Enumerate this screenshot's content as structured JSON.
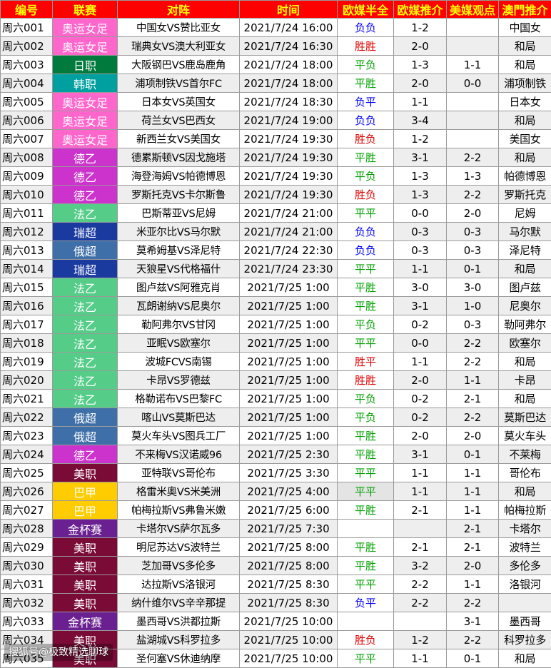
{
  "header": {
    "id": "编号",
    "league": "联赛",
    "match": "对阵",
    "time": "时间",
    "eu_halffull": "欧媒半全",
    "eu_recommend": "欧媒推介",
    "us_view": "美媒观点",
    "macau_recommend": "澳門推介"
  },
  "league_colors": {
    "奥运女足": "#ff66cc",
    "日职": "#007a3d",
    "韩职": "#00a0a0",
    "德乙": "#cc33cc",
    "法乙": "#55cc88",
    "瑞超": "#1a3aa0",
    "俄超": "#3f6fa8",
    "美职": "#7a0a36",
    "巴甲": "#ffcc00",
    "金杯赛": "#6a2090"
  },
  "rows": [
    {
      "id": "周六001",
      "league": "奥运女足",
      "match": "中国女VS赞比亚女",
      "time": "2021/7/24 16:00",
      "odds": "负负",
      "odds_color": "blue",
      "recommend": "1-2",
      "us": "",
      "macau": "中国女"
    },
    {
      "id": "周六002",
      "league": "奥运女足",
      "match": "瑞典女VS澳大利亚女",
      "time": "2021/7/24 16:30",
      "odds": "胜胜",
      "odds_color": "red",
      "recommend": "2-0",
      "us": "",
      "macau": "和局"
    },
    {
      "id": "周六003",
      "league": "日职",
      "match": "大阪钢巴VS鹿岛鹿角",
      "time": "2021/7/24 18:00",
      "odds": "平负",
      "odds_color": "green",
      "recommend": "1-3",
      "us": "1-1",
      "macau": "和局"
    },
    {
      "id": "周六004",
      "league": "韩职",
      "match": "浦项制铁VS首尔FC",
      "time": "2021/7/24 18:00",
      "odds": "平胜",
      "odds_color": "green",
      "recommend": "2-0",
      "us": "0-0",
      "macau": "浦项制铁"
    },
    {
      "id": "周六005",
      "league": "奥运女足",
      "match": "日本女VS英国女",
      "time": "2021/7/24 18:30",
      "odds": "负平",
      "odds_color": "blue",
      "recommend": "1-1",
      "us": "",
      "macau": "日本女"
    },
    {
      "id": "周六006",
      "league": "奥运女足",
      "match": "荷兰女VS巴西女",
      "time": "2021/7/24 19:00",
      "odds": "负负",
      "odds_color": "blue",
      "recommend": "3-4",
      "us": "",
      "macau": "和局"
    },
    {
      "id": "周六007",
      "league": "奥运女足",
      "match": "新西兰女VS美国女",
      "time": "2021/7/24 19:30",
      "odds": "胜负",
      "odds_color": "red",
      "recommend": "1-2",
      "us": "",
      "macau": "美国女"
    },
    {
      "id": "周六008",
      "league": "德乙",
      "match": "德累斯顿VS因戈施塔",
      "time": "2021/7/24 19:30",
      "odds": "平胜",
      "odds_color": "green",
      "recommend": "3-1",
      "us": "2-2",
      "macau": "和局"
    },
    {
      "id": "周六009",
      "league": "德乙",
      "match": "海登海姆VS帕德博恩",
      "time": "2021/7/24 19:30",
      "odds": "平负",
      "odds_color": "green",
      "recommend": "1-3",
      "us": "1-3",
      "macau": "帕德博恩"
    },
    {
      "id": "周六010",
      "league": "德乙",
      "match": "罗斯托克VS卡尔斯鲁",
      "time": "2021/7/24 19:30",
      "odds": "胜负",
      "odds_color": "red",
      "recommend": "1-3",
      "us": "2-2",
      "macau": "罗斯托克"
    },
    {
      "id": "周六011",
      "league": "法乙",
      "match": "巴斯蒂亚VS尼姆",
      "time": "2021/7/24 21:00",
      "odds": "平平",
      "odds_color": "green",
      "recommend": "0-0",
      "us": "2-0",
      "macau": "尼姆"
    },
    {
      "id": "周六012",
      "league": "瑞超",
      "match": "米亚尔比VS马尔默",
      "time": "2021/7/24 21:00",
      "odds": "负负",
      "odds_color": "blue",
      "recommend": "0-3",
      "us": "0-3",
      "macau": "马尔默"
    },
    {
      "id": "周六013",
      "league": "俄超",
      "match": "莫希姆基VS泽尼特",
      "time": "2021/7/24 22:30",
      "odds": "负负",
      "odds_color": "blue",
      "recommend": "0-3",
      "us": "0-3",
      "macau": "泽尼特"
    },
    {
      "id": "周六014",
      "league": "瑞超",
      "match": "天狼星VS代格福什",
      "time": "2021/7/24 23:30",
      "odds": "平平",
      "odds_color": "green",
      "recommend": "1-1",
      "us": "0-1",
      "macau": "和局"
    },
    {
      "id": "周六015",
      "league": "法乙",
      "match": "图卢兹VS阿雅克肖",
      "time": "2021/7/25 1:00",
      "odds": "平胜",
      "odds_color": "green",
      "recommend": "3-0",
      "us": "3-0",
      "macau": "图卢兹"
    },
    {
      "id": "周六016",
      "league": "法乙",
      "match": "瓦朗谢纳VS尼奥尔",
      "time": "2021/7/25 1:00",
      "odds": "平胜",
      "odds_color": "green",
      "recommend": "3-1",
      "us": "1-0",
      "macau": "尼奥尔"
    },
    {
      "id": "周六017",
      "league": "法乙",
      "match": "勒阿弗尔VS甘冈",
      "time": "2021/7/25 1:00",
      "odds": "平负",
      "odds_color": "green",
      "recommend": "0-2",
      "us": "0-3",
      "macau": "勒阿弗尔"
    },
    {
      "id": "周六018",
      "league": "法乙",
      "match": "亚眠VS欧塞尔",
      "time": "2021/7/25 1:00",
      "odds": "平平",
      "odds_color": "green",
      "recommend": "0-0",
      "us": "2-2",
      "macau": "欧塞尔"
    },
    {
      "id": "周六019",
      "league": "法乙",
      "match": "波城FCVS南锡",
      "time": "2021/7/25 1:00",
      "odds": "胜平",
      "odds_color": "red",
      "recommend": "1-1",
      "us": "2-2",
      "macau": "和局"
    },
    {
      "id": "周六020",
      "league": "法乙",
      "match": "卡昂VS罗德兹",
      "time": "2021/7/25 1:00",
      "odds": "胜胜",
      "odds_color": "red",
      "recommend": "2-0",
      "us": "1-1",
      "macau": "卡昂"
    },
    {
      "id": "周六021",
      "league": "法乙",
      "match": "格勒诺布VS巴黎FC",
      "time": "2021/7/25 1:00",
      "odds": "平负",
      "odds_color": "green",
      "recommend": "0-2",
      "us": "2-1",
      "macau": "和局"
    },
    {
      "id": "周六022",
      "league": "俄超",
      "match": "喀山VS莫斯巴达",
      "time": "2021/7/25 1:00",
      "odds": "平负",
      "odds_color": "green",
      "recommend": "0-2",
      "us": "2-2",
      "macau": "莫斯巴达"
    },
    {
      "id": "周六023",
      "league": "俄超",
      "match": "莫火车头VS图兵工厂",
      "time": "2021/7/25 1:00",
      "odds": "平胜",
      "odds_color": "green",
      "recommend": "2-0",
      "us": "2-0",
      "macau": "莫火车头"
    },
    {
      "id": "周六024",
      "league": "德乙",
      "match": "不来梅VS汉诺威96",
      "time": "2021/7/25 2:30",
      "odds": "平胜",
      "odds_color": "green",
      "recommend": "3-1",
      "us": "0-1",
      "macau": "不莱梅"
    },
    {
      "id": "周六025",
      "league": "美职",
      "match": "亚特联VS哥伦布",
      "time": "2021/7/25 3:30",
      "odds": "平平",
      "odds_color": "green",
      "recommend": "1-1",
      "us": "1-1",
      "macau": "哥伦布"
    },
    {
      "id": "周六026",
      "league": "巴甲",
      "match": "格雷米奥VS米美洲",
      "time": "2021/7/25 4:00",
      "odds": "平平",
      "odds_color": "green",
      "recommend": "1-1",
      "us": "1-1",
      "macau": "和局",
      "odds_shade": true
    },
    {
      "id": "周六027",
      "league": "巴甲",
      "match": "帕梅拉斯VS弗鲁米嫩",
      "time": "2021/7/25 6:00",
      "odds": "平胜",
      "odds_color": "green",
      "recommend": "2-1",
      "us": "1-1",
      "macau": "帕梅拉斯"
    },
    {
      "id": "周六028",
      "league": "金杯赛",
      "match": "卡塔尔VS萨尔瓦多",
      "time": "2021/7/25 7:30",
      "odds": "",
      "odds_color": "green",
      "recommend": "",
      "us": "2-1",
      "macau": "卡塔尔"
    },
    {
      "id": "周六029",
      "league": "美职",
      "match": "明尼苏达VS波特兰",
      "time": "2021/7/25 8:00",
      "odds": "平胜",
      "odds_color": "green",
      "recommend": "2-1",
      "us": "2-1",
      "macau": "波特兰"
    },
    {
      "id": "周六030",
      "league": "美职",
      "match": "芝加哥VS多伦多",
      "time": "2021/7/25 8:00",
      "odds": "平胜",
      "odds_color": "green",
      "recommend": "3-2",
      "us": "2-0",
      "macau": "多伦多"
    },
    {
      "id": "周六031",
      "league": "美职",
      "match": "达拉斯VS洛银河",
      "time": "2021/7/25 8:30",
      "odds": "平平",
      "odds_color": "green",
      "recommend": "2-2",
      "us": "1-1",
      "macau": "洛银河"
    },
    {
      "id": "周六032",
      "league": "美职",
      "match": "纳什维尔VS辛辛那提",
      "time": "2021/7/25 8:30",
      "odds": "负平",
      "odds_color": "blue",
      "recommend": "2-2",
      "us": "2-2",
      "macau": ""
    },
    {
      "id": "周六033",
      "league": "金杯赛",
      "match": "墨西哥VS洪都拉斯",
      "time": "2021/7/25 10:00",
      "odds": "",
      "odds_color": "green",
      "recommend": "",
      "us": "3-1",
      "macau": "墨西哥"
    },
    {
      "id": "周六034",
      "league": "美职",
      "match": "盐湖城VS科罗拉多",
      "time": "2021/7/25 10:00",
      "odds": "胜负",
      "odds_color": "red",
      "recommend": "1-2",
      "us": "2-2",
      "macau": "科罗拉多"
    },
    {
      "id": "周六035",
      "league": "美职",
      "match": "圣何塞VS休迪纳摩",
      "time": "2021/7/25 10:00",
      "odds": "平平",
      "odds_color": "green",
      "recommend": "1-1",
      "us": "0-1",
      "macau": "和局"
    }
  ],
  "watermark": "搜狐号@极致精选聊球"
}
